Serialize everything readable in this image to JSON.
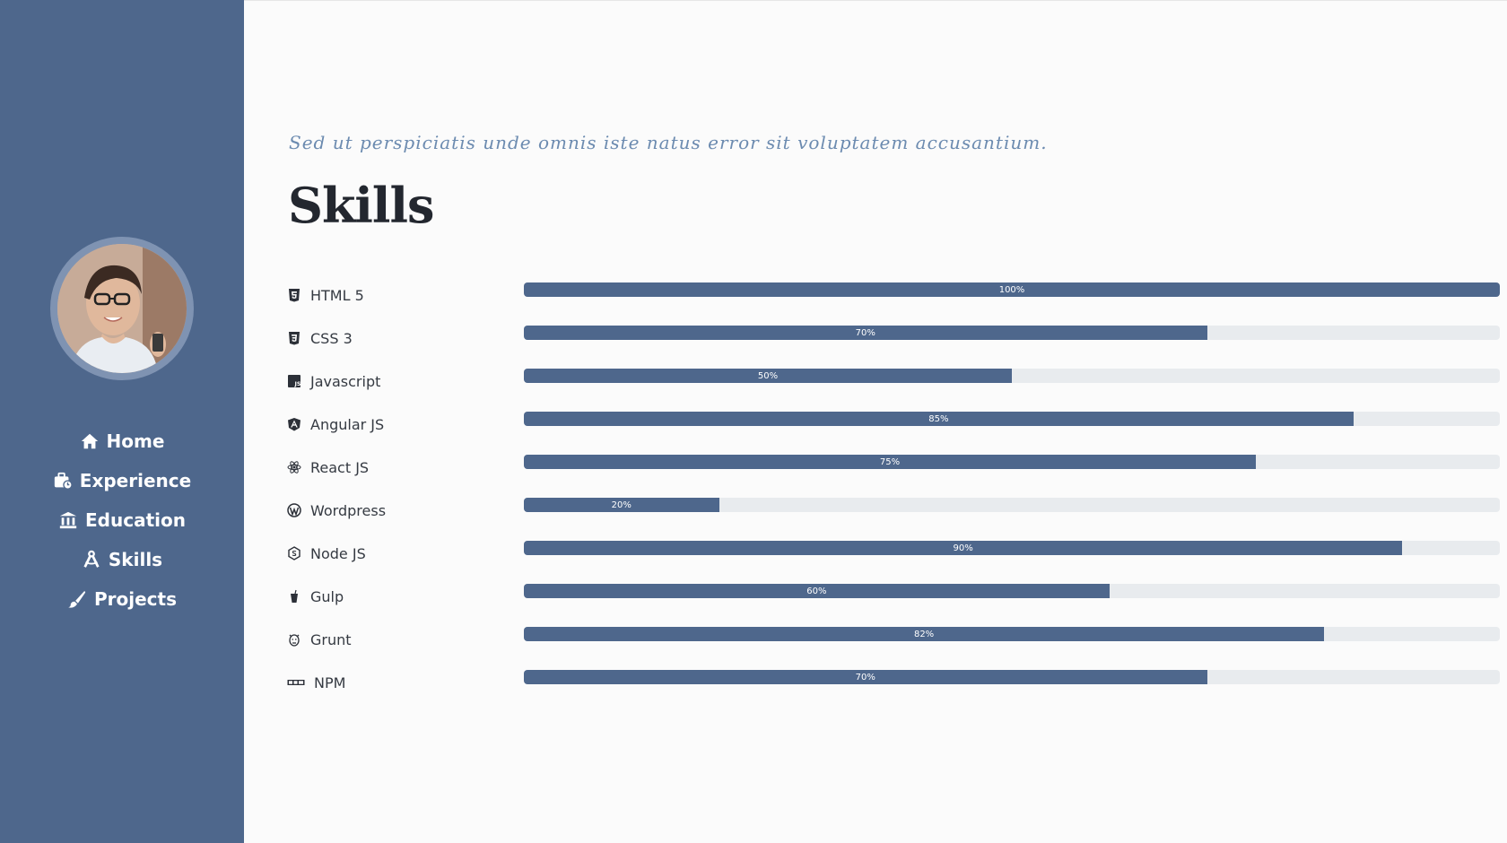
{
  "colors": {
    "sidebar": "#4e678c",
    "accent": "#4e678c",
    "track": "#e8ebee"
  },
  "sidebar": {
    "avatar_alt": "profile photo",
    "nav": [
      {
        "label": "Home",
        "icon": "home-icon"
      },
      {
        "label": "Experience",
        "icon": "briefcase-icon"
      },
      {
        "label": "Education",
        "icon": "university-icon"
      },
      {
        "label": "Skills",
        "icon": "drafting-compass-icon"
      },
      {
        "label": "Projects",
        "icon": "paint-brush-icon"
      }
    ]
  },
  "main": {
    "subtitle": "Sed ut perspiciatis unde omnis iste natus error sit voluptatem accusantium.",
    "title": "Skills",
    "skills": [
      {
        "name": "HTML 5",
        "icon": "html5-icon",
        "percent": 100,
        "label": "100%"
      },
      {
        "name": "CSS 3",
        "icon": "css3-icon",
        "percent": 70,
        "label": "70%"
      },
      {
        "name": "Javascript",
        "icon": "js-icon",
        "percent": 50,
        "label": "50%"
      },
      {
        "name": "Angular JS",
        "icon": "angular-icon",
        "percent": 85,
        "label": "85%"
      },
      {
        "name": "React JS",
        "icon": "react-icon",
        "percent": 75,
        "label": "75%"
      },
      {
        "name": "Wordpress",
        "icon": "wordpress-icon",
        "percent": 20,
        "label": "20%"
      },
      {
        "name": "Node JS",
        "icon": "node-icon",
        "percent": 90,
        "label": "90%"
      },
      {
        "name": "Gulp",
        "icon": "gulp-icon",
        "percent": 60,
        "label": "60%"
      },
      {
        "name": "Grunt",
        "icon": "grunt-icon",
        "percent": 82,
        "label": "82%"
      },
      {
        "name": "NPM",
        "icon": "npm-icon",
        "percent": 70,
        "label": "70%"
      }
    ]
  }
}
